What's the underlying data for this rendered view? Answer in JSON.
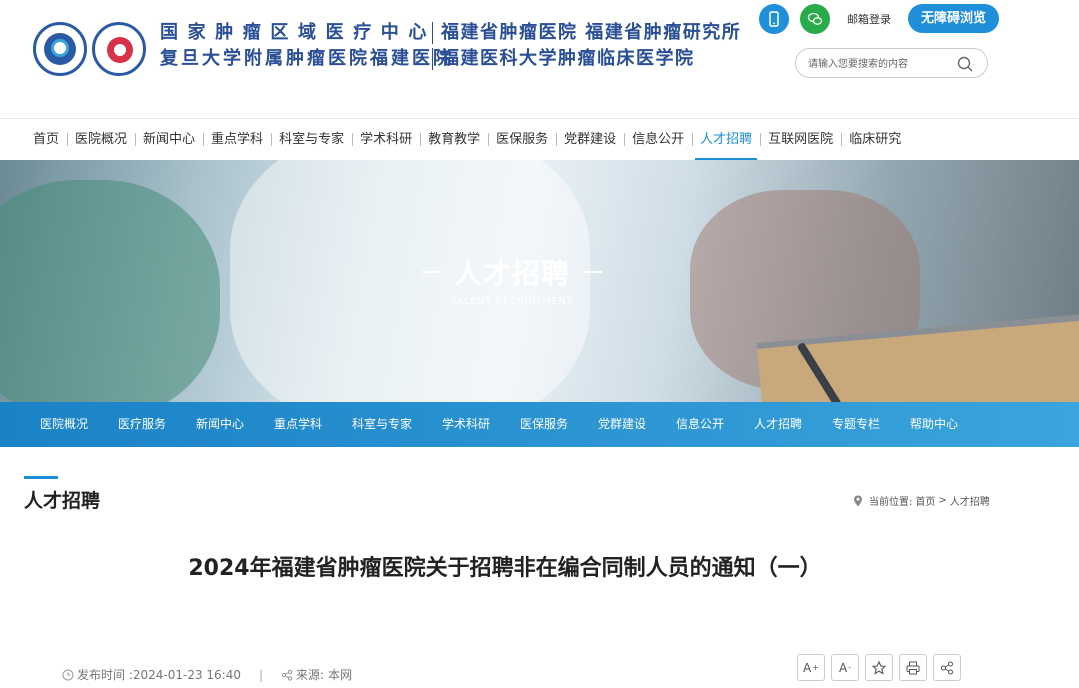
{
  "header": {
    "titles": {
      "row1_left": "国家肿瘤区域医疗中心",
      "row1_right": "福建省肿瘤医院 福建省肿瘤研究所",
      "row2_left": "复旦大学附属肿瘤医院福建医院",
      "row2_right": "福建医科大学肿瘤临床医学院"
    },
    "mail_login": "邮箱登录",
    "accessibility_button": "无障碍浏览",
    "search_placeholder": "请输入您要搜索的内容"
  },
  "main_nav": {
    "items": [
      "首页",
      "医院概况",
      "新闻中心",
      "重点学科",
      "科室与专家",
      "学术科研",
      "教育教学",
      "医保服务",
      "党群建设",
      "信息公开",
      "人才招聘",
      "互联网医院",
      "临床研究"
    ],
    "active": "人才招聘"
  },
  "banner": {
    "title": "人才招聘",
    "subtitle": "TALENT RECRUITMENT"
  },
  "sub_nav": {
    "items": [
      "医院概况",
      "医疗服务",
      "新闻中心",
      "重点学科",
      "科室与专家",
      "学术科研",
      "医保服务",
      "党群建设",
      "信息公开",
      "人才招聘",
      "专题专栏",
      "帮助中心"
    ]
  },
  "section": {
    "title": "人才招聘",
    "breadcrumb_prefix": "当前位置:",
    "breadcrumb_home": "首页",
    "breadcrumb_sep": ">",
    "breadcrumb_current": "人才招聘"
  },
  "article": {
    "title": "2024年福建省肿瘤医院关于招聘非在编合同制人员的通知（一）",
    "publish_label": "发布时间 :",
    "publish_time": "2024-01-23 16:40",
    "separator": "|",
    "source_label": "来源:",
    "source": "本网"
  },
  "tools": {
    "font_larger": "A",
    "font_larger_mark": "+",
    "font_smaller": "A",
    "font_smaller_mark": "-"
  },
  "colors": {
    "brand_blue": "#1e8fd8",
    "title_blue": "#2a4f96",
    "wechat_green": "#2aab4b"
  }
}
